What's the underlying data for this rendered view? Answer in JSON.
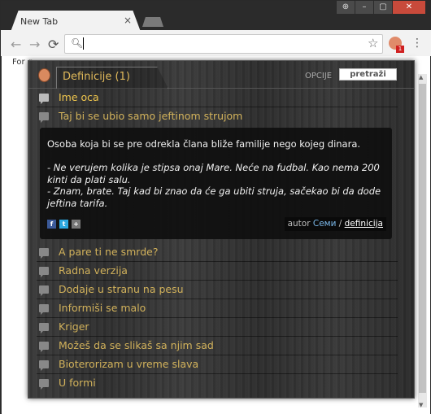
{
  "browser": {
    "tab_title": "New Tab",
    "tab_close": "×",
    "window_buttons": {
      "account": "⊕",
      "minimize": "–",
      "maximize": "▢",
      "close": "✕"
    },
    "nav": {
      "back": "←",
      "forward": "→",
      "reload": "⟳"
    },
    "omnibox_value": "",
    "extension_badge": "1",
    "bookmarks_text": "For q"
  },
  "popup": {
    "header": {
      "tab_title": "Definicije (1)",
      "options_label": "OPCIJE",
      "search_button": "pretraži"
    },
    "items": [
      {
        "label": "Ime oca",
        "state": "selected"
      },
      {
        "label": "Taj bi se ubio samo jeftinom strujom",
        "state": "open"
      },
      {
        "label": "A pare ti ne smrde?"
      },
      {
        "label": "Radna verzija"
      },
      {
        "label": "Dodaje u stranu na pesu"
      },
      {
        "label": "Informiši se malo"
      },
      {
        "label": "Kriger"
      },
      {
        "label": "Možeš da se slikaš sa njim sad"
      },
      {
        "label": "Bioterorizam u vreme slava"
      },
      {
        "label": "U formi"
      }
    ],
    "definition": {
      "text": "Osoba koja bi se pre odrekla člana bliže familije nego kojeg dinara.",
      "example_lines": [
        "- Ne verujem kolika je stipsa onaj Mare. Neće na fudbal. Kao nema 200 kinti da plati salu.",
        "- Znam, brate. Taj kad bi znao da će ga ubiti struja, sačekao bi da dode jeftina tarifa."
      ],
      "share": {
        "facebook": "f",
        "twitter": "t",
        "plus": "+"
      },
      "author_prefix": "autor",
      "author_name": "Семи",
      "separator": "/",
      "author_link": "definicija"
    }
  },
  "colors": {
    "accent": "#e0b95a",
    "item_text": "#d2b25b",
    "author_name": "#7ab7e8"
  }
}
